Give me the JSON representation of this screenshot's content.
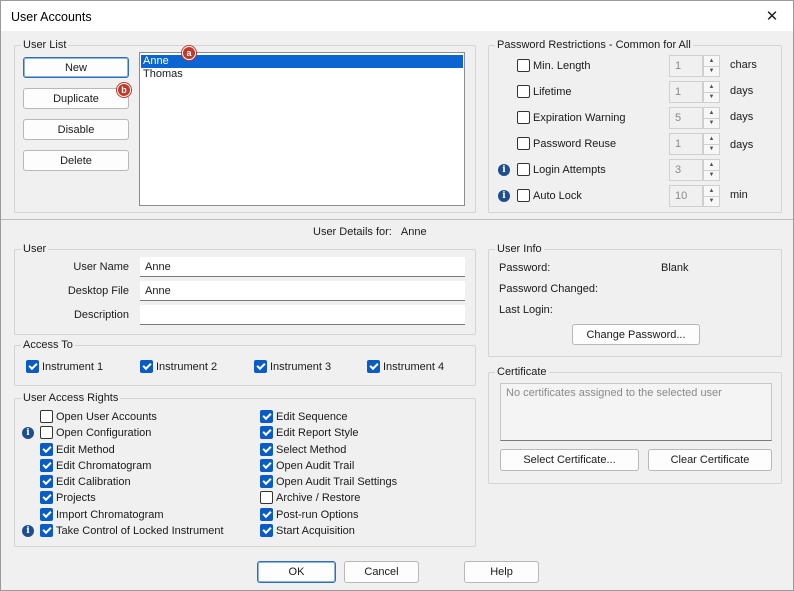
{
  "window": {
    "title": "User Accounts",
    "close_glyph": "✕"
  },
  "user_list": {
    "label": "User List",
    "buttons": {
      "new": "New",
      "duplicate": "Duplicate",
      "disable": "Disable",
      "delete": "Delete"
    },
    "users": [
      "Anne",
      "Thomas"
    ],
    "selected_user": "Anne",
    "badges": {
      "a": "a",
      "b": "b"
    }
  },
  "password_restrictions": {
    "label": "Password Restrictions - Common for All",
    "rows": [
      {
        "label": "Min. Length",
        "checked": false,
        "value": "1",
        "unit": "chars",
        "info": false
      },
      {
        "label": "Lifetime",
        "checked": false,
        "value": "1",
        "unit": "days",
        "info": false
      },
      {
        "label": "Expiration Warning",
        "checked": false,
        "value": "5",
        "unit": "days",
        "info": false
      },
      {
        "label": "Password Reuse",
        "checked": false,
        "value": "1",
        "unit": "days",
        "info": false
      },
      {
        "label": "Login Attempts",
        "checked": false,
        "value": "3",
        "unit": "",
        "info": true
      },
      {
        "label": "Auto Lock",
        "checked": false,
        "value": "10",
        "unit": "min",
        "info": true
      }
    ]
  },
  "details_header": {
    "label": "User Details for:",
    "user": "Anne"
  },
  "user": {
    "label": "User",
    "fields": {
      "user_name_label": "User Name",
      "user_name": "Anne",
      "desktop_file_label": "Desktop File",
      "desktop_file": "Anne",
      "description_label": "Description",
      "description": ""
    }
  },
  "user_info": {
    "label": "User Info",
    "password_label": "Password:",
    "password_value": "Blank",
    "password_changed_label": "Password Changed:",
    "last_login_label": "Last Login:",
    "change_password": "Change Password..."
  },
  "access_to": {
    "label": "Access To",
    "instruments": [
      {
        "label": "Instrument 1",
        "checked": true
      },
      {
        "label": "Instrument 2",
        "checked": true
      },
      {
        "label": "Instrument 3",
        "checked": true
      },
      {
        "label": "Instrument 4",
        "checked": true
      }
    ]
  },
  "access_rights": {
    "label": "User Access Rights",
    "left": [
      {
        "label": "Open User Accounts",
        "checked": false,
        "info": false
      },
      {
        "label": "Open Configuration",
        "checked": false,
        "info": true
      },
      {
        "label": "Edit Method",
        "checked": true,
        "info": false
      },
      {
        "label": "Edit Chromatogram",
        "checked": true,
        "info": false
      },
      {
        "label": "Edit Calibration",
        "checked": true,
        "info": false
      },
      {
        "label": "Projects",
        "checked": true,
        "info": false
      },
      {
        "label": "Import Chromatogram",
        "checked": true,
        "info": false
      },
      {
        "label": "Take Control of Locked Instrument",
        "checked": true,
        "info": true
      }
    ],
    "right": [
      {
        "label": "Edit Sequence",
        "checked": true
      },
      {
        "label": "Edit Report Style",
        "checked": true
      },
      {
        "label": "Select Method",
        "checked": true
      },
      {
        "label": "Open Audit Trail",
        "checked": true
      },
      {
        "label": "Open Audit Trail Settings",
        "checked": true
      },
      {
        "label": "Archive / Restore",
        "checked": false
      },
      {
        "label": "Post-run Options",
        "checked": true
      },
      {
        "label": "Start Acquisition",
        "checked": true
      }
    ]
  },
  "certificate": {
    "label": "Certificate",
    "empty_text": "No certificates assigned to the selected user",
    "select": "Select Certificate...",
    "clear": "Clear Certificate"
  },
  "footer": {
    "ok": "OK",
    "cancel": "Cancel",
    "help": "Help"
  },
  "colors": {
    "accent": "#0a5cc4",
    "selection": "#0a64d2",
    "badge": "#c0392b",
    "info": "#1f4e8c"
  }
}
